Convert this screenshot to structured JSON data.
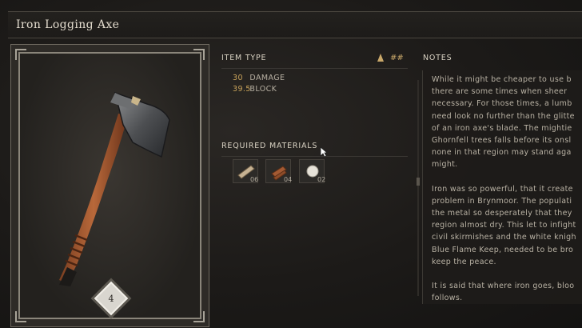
{
  "window": {
    "title": "Iron Logging Axe"
  },
  "card": {
    "tier": "4",
    "image_icon": "iron-axe-icon"
  },
  "item_type": {
    "heading": "ITEM TYPE",
    "tag": "##",
    "stats": [
      {
        "value": "30",
        "label": "DAMAGE"
      },
      {
        "value": "39.5",
        "label": "BLOCK"
      }
    ]
  },
  "required_materials": {
    "heading": "REQUIRED MATERIALS",
    "items": [
      {
        "icon": "plank-icon",
        "quantity": "06"
      },
      {
        "icon": "logs-icon",
        "quantity": "04"
      },
      {
        "icon": "cotton-ball-icon",
        "quantity": "02"
      }
    ]
  },
  "notes": {
    "heading": "NOTES",
    "paragraphs": [
      [
        "While it might be cheaper to use b",
        "there are some times when sheer",
        "necessary. For those times, a lumb",
        "need look no further than the glitte",
        "of an iron axe's blade. The mightie",
        "Ghornfell trees falls before its onsl",
        "none in that region may stand aga",
        "might."
      ],
      [
        "Iron was so powerful, that it create",
        "problem in Brynmoor. The populati",
        "the metal so desperately that they",
        "region almost dry. This let to infight",
        "civil skirmishes and the white knigh",
        "Blue Flame Keep, needed to be bro",
        "keep the peace."
      ],
      [
        "It is said that where iron goes, bloo",
        "follows."
      ]
    ]
  },
  "colors": {
    "accent": "#c9a35a",
    "text": "#b9b2a4",
    "heading": "#d9d2c3"
  }
}
